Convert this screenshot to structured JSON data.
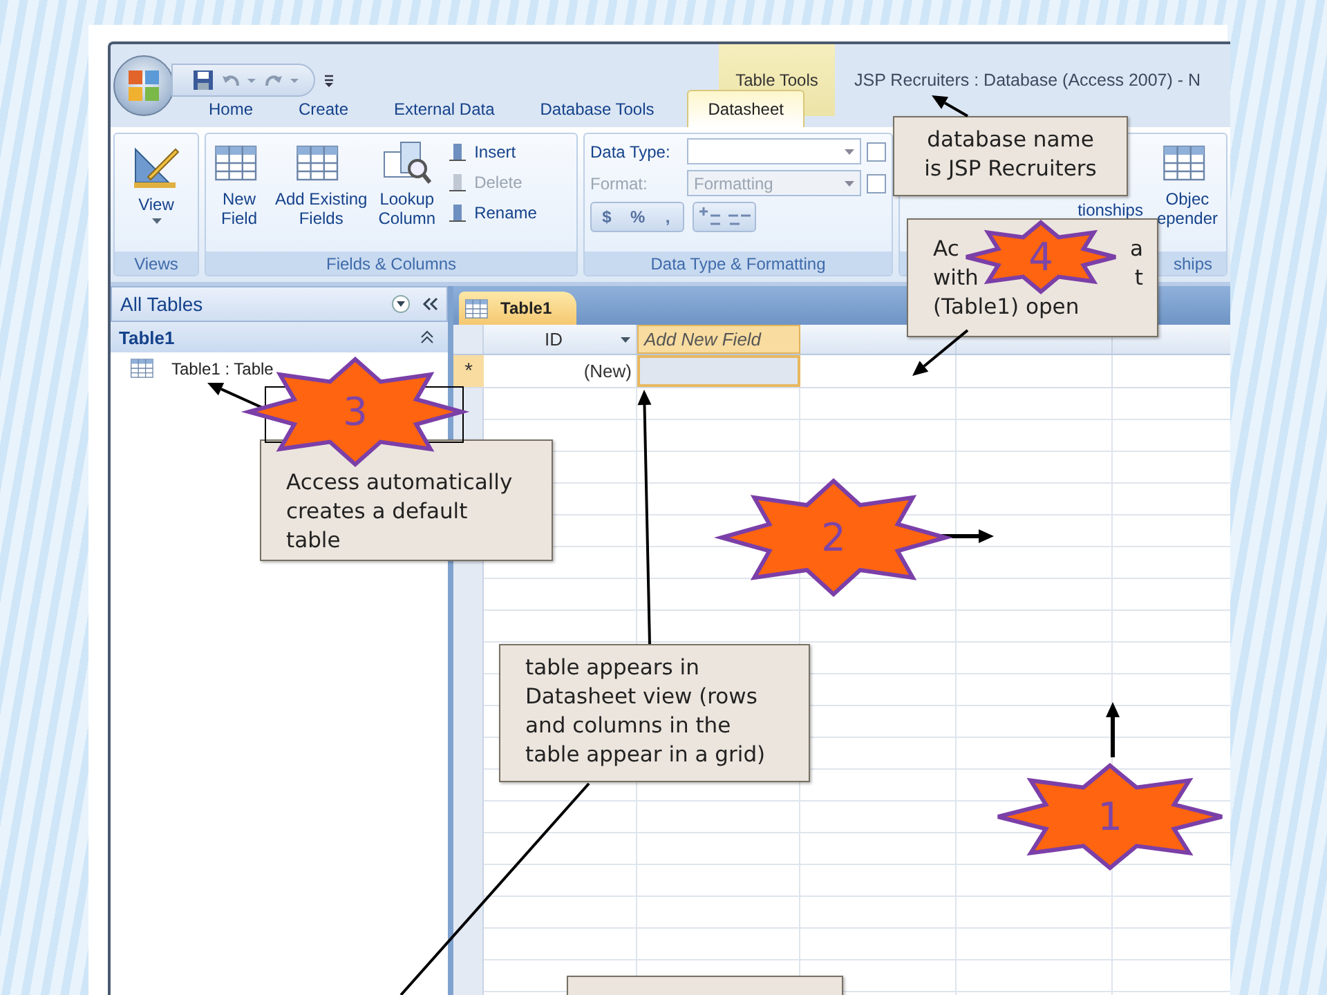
{
  "window": {
    "title": "JSP Recruiters : Database (Access 2007) - N",
    "contextual_group": "Table Tools"
  },
  "tabs": [
    {
      "label": "Home",
      "selected": false
    },
    {
      "label": "Create",
      "selected": false
    },
    {
      "label": "External Data",
      "selected": false
    },
    {
      "label": "Database Tools",
      "selected": false
    },
    {
      "label": "Datasheet",
      "selected": true
    }
  ],
  "ribbon": {
    "views": {
      "label": "Views",
      "button": "View"
    },
    "fields_columns": {
      "label": "Fields & Columns",
      "large_buttons": [
        {
          "lines": [
            "New",
            "Field"
          ]
        },
        {
          "lines": [
            "Add Existing",
            "Fields"
          ]
        },
        {
          "lines": [
            "Lookup",
            "Column"
          ]
        }
      ],
      "small_buttons": [
        {
          "label": "Insert",
          "disabled": false
        },
        {
          "label": "Delete",
          "disabled": true
        },
        {
          "label": "Rename",
          "disabled": false
        }
      ]
    },
    "data_type": {
      "label": "Data Type & Formatting",
      "fields": [
        {
          "label": "Data Type:",
          "disabled": false,
          "checked": false
        },
        {
          "label": "Format:",
          "value": "Formatting",
          "disabled": true,
          "checked": false
        }
      ],
      "format_buttons": [
        "$",
        "%",
        ","
      ]
    },
    "relationships": {
      "label": "ships",
      "buttons": [
        {
          "lines": [
            "tionships"
          ]
        },
        {
          "lines": [
            "Objec",
            "epender"
          ]
        }
      ]
    }
  },
  "navigation": {
    "header": "All Tables",
    "group": "Table1",
    "items": [
      {
        "label": "Table1 : Table"
      }
    ]
  },
  "document": {
    "tab": "Table1",
    "columns": [
      {
        "label": "ID",
        "kind": "field"
      },
      {
        "label": "Add New Field",
        "kind": "add"
      }
    ],
    "new_row": {
      "marker": "*",
      "id": "(New)"
    }
  },
  "callouts": [
    {
      "kind": "note",
      "lines": [
        "database name",
        "is JSP Recruiters"
      ]
    },
    {
      "kind": "covered",
      "lines": [
        [
          "Ac",
          "a"
        ],
        [
          "with",
          "t"
        ],
        [
          "(Table1) open"
        ]
      ]
    },
    {
      "kind": "note",
      "lines": [
        "Access automatically",
        "creates a default",
        "table"
      ]
    },
    {
      "kind": "note",
      "lines": [
        "table appears in",
        "Datasheet view (rows",
        "and columns in the",
        "table appear in a grid)"
      ]
    },
    {
      "kind": "blank"
    }
  ],
  "stars": [
    {
      "number": "4"
    },
    {
      "number": "3"
    },
    {
      "number": "2"
    },
    {
      "number": "1"
    }
  ]
}
